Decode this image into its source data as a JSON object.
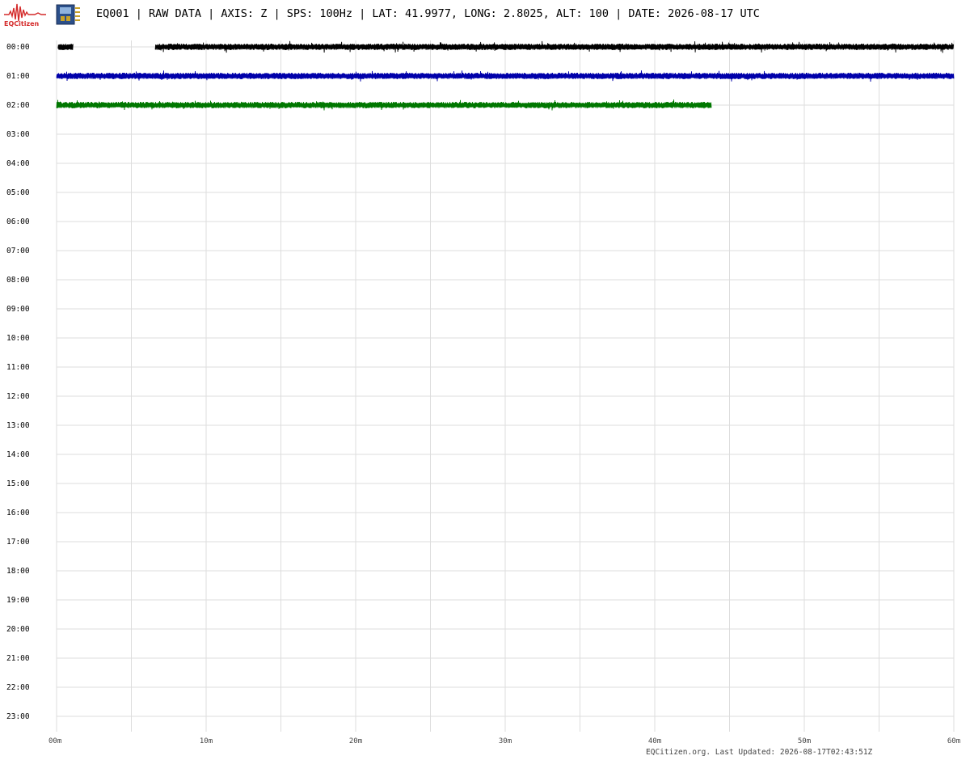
{
  "header": {
    "logo_text": "EQCitizen",
    "title": "EQ001 | RAW DATA | AXIS: Z | SPS: 100Hz | LAT: 41.9977, LONG: 2.8025, ALT: 100 | DATE: 2026-08-17 UTC"
  },
  "icons": [
    "seismograph-logo-icon",
    "sensor-board-icon"
  ],
  "footer": {
    "text": "EQCitizen.org. Last Updated: 2026-08-17T02:43:51Z"
  },
  "chart_data": {
    "type": "line",
    "title": "",
    "xlabel": "",
    "ylabel": "",
    "x_unit": "minutes",
    "xlim": [
      0,
      60
    ],
    "x_ticks": [
      "00m",
      "10m",
      "20m",
      "30m",
      "40m",
      "50m",
      "60m"
    ],
    "y_ticks": [
      "00:00",
      "01:00",
      "02:00",
      "03:00",
      "04:00",
      "05:00",
      "06:00",
      "07:00",
      "08:00",
      "09:00",
      "10:00",
      "11:00",
      "12:00",
      "13:00",
      "14:00",
      "15:00",
      "16:00",
      "17:00",
      "18:00",
      "19:00",
      "20:00",
      "21:00",
      "22:00",
      "23:00"
    ],
    "grid": true,
    "series": [
      {
        "row": "00:00",
        "color": "#000000",
        "segments": [
          [
            0.1,
            1.1
          ],
          [
            6.6,
            60
          ]
        ]
      },
      {
        "row": "01:00",
        "color": "#0000aa",
        "segments": [
          [
            0,
            60
          ]
        ]
      },
      {
        "row": "02:00",
        "color": "#007700",
        "segments": [
          [
            0,
            43.8
          ]
        ]
      }
    ]
  }
}
